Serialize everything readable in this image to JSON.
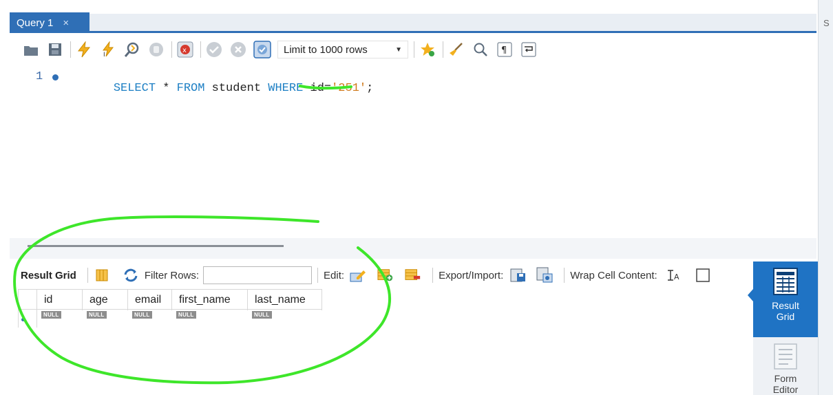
{
  "tabs": [
    {
      "label": "Query 1",
      "close_glyph": "×"
    }
  ],
  "right_pane_letter": "S",
  "toolbar": {
    "limit_select_value": "Limit to 1000 rows",
    "icons": [
      "folder-open-icon",
      "save-icon",
      "execute-icon",
      "execute-current-icon",
      "explain-icon",
      "stop-icon",
      "toggle-error-icon",
      "commit-icon",
      "rollback-icon",
      "autocommit-icon",
      "beautify-icon",
      "find-icon",
      "invisible-chars-icon",
      "wrap-icon"
    ]
  },
  "editor": {
    "line_number": "1",
    "code_tokens": [
      {
        "text": "SELECT",
        "kind": "kw"
      },
      {
        "text": " * ",
        "kind": "id"
      },
      {
        "text": "FROM",
        "kind": "kw"
      },
      {
        "text": " student ",
        "kind": "id"
      },
      {
        "text": "WHERE",
        "kind": "kw"
      },
      {
        "text": " id=",
        "kind": "id"
      },
      {
        "text": "'251'",
        "kind": "str"
      },
      {
        "text": ";",
        "kind": "id"
      }
    ]
  },
  "result_toolbar": {
    "result_grid_label": "Result Grid",
    "filter_label": "Filter Rows:",
    "filter_value": "",
    "edit_label": "Edit:",
    "export_label": "Export/Import:",
    "wrap_label": "Wrap Cell Content:"
  },
  "grid": {
    "columns": [
      "id",
      "age",
      "email",
      "first_name",
      "last_name"
    ],
    "rows": [
      [
        "NULL",
        "NULL",
        "NULL",
        "NULL",
        "NULL"
      ]
    ]
  },
  "side_panel": {
    "result_grid": "Result Grid",
    "form_editor": "Form Editor"
  },
  "colors": {
    "accent": "#2f6fb6",
    "keyword": "#1d7fc4",
    "string": "#d07a1c",
    "annotation": "#3ee62a"
  }
}
